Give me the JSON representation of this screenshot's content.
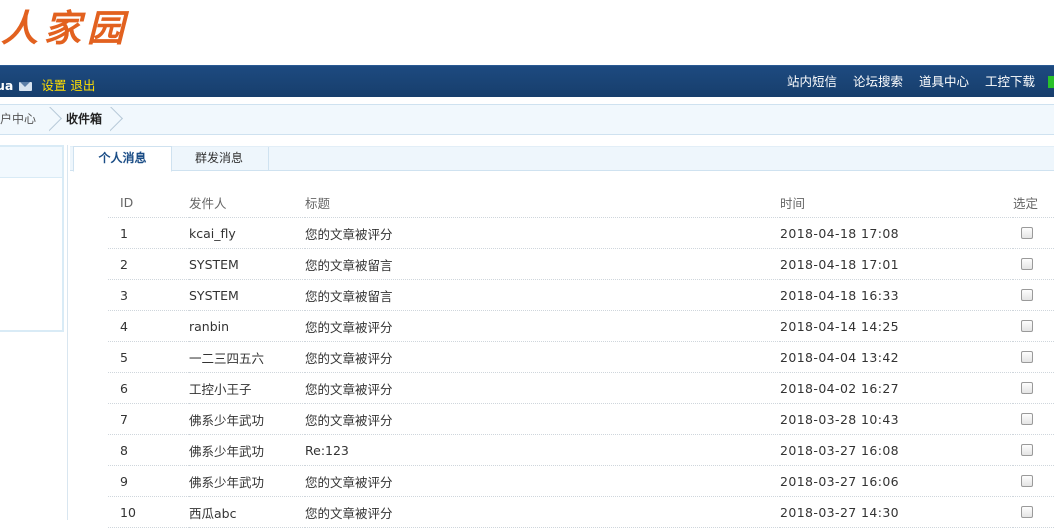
{
  "logo": {
    "text": "工人家园"
  },
  "topbar": {
    "username": "ua",
    "settings_label": "设置",
    "logout_label": "退出",
    "nav": [
      "站内短信",
      "论坛搜索",
      "道具中心",
      "工控下载"
    ]
  },
  "breadcrumb": {
    "parent": "用户中心",
    "current": "收件箱"
  },
  "tabs": {
    "personal": "个人消息",
    "group": "群发消息"
  },
  "table": {
    "headers": {
      "id": "ID",
      "sender": "发件人",
      "title": "标题",
      "time": "时间",
      "select": "选定"
    },
    "rows": [
      {
        "id": "1",
        "sender": "kcai_fly",
        "title": "您的文章被评分",
        "time": "2018-04-18 17:08"
      },
      {
        "id": "2",
        "sender": "SYSTEM",
        "title": "您的文章被留言",
        "time": "2018-04-18 17:01"
      },
      {
        "id": "3",
        "sender": "SYSTEM",
        "title": "您的文章被留言",
        "time": "2018-04-18 16:33"
      },
      {
        "id": "4",
        "sender": "ranbin",
        "title": "您的文章被评分",
        "time": "2018-04-14 14:25"
      },
      {
        "id": "5",
        "sender": "一二三四五六",
        "title": "您的文章被评分",
        "time": "2018-04-04 13:42"
      },
      {
        "id": "6",
        "sender": "工控小王子",
        "title": "您的文章被评分",
        "time": "2018-04-02 16:27"
      },
      {
        "id": "7",
        "sender": "佛系少年武功",
        "title": "您的文章被评分",
        "time": "2018-03-28 10:43"
      },
      {
        "id": "8",
        "sender": "佛系少年武功",
        "title": "Re:123",
        "time": "2018-03-27 16:08"
      },
      {
        "id": "9",
        "sender": "佛系少年武功",
        "title": "您的文章被评分",
        "time": "2018-03-27 16:06"
      },
      {
        "id": "10",
        "sender": "西瓜abc",
        "title": "您的文章被评分",
        "time": "2018-03-27 14:30"
      }
    ]
  },
  "colors": {
    "logo": "#e2611f",
    "topbar": "#1d4a80",
    "link_yellow": "#ffde00",
    "tab_active_text": "#1b4d86"
  }
}
